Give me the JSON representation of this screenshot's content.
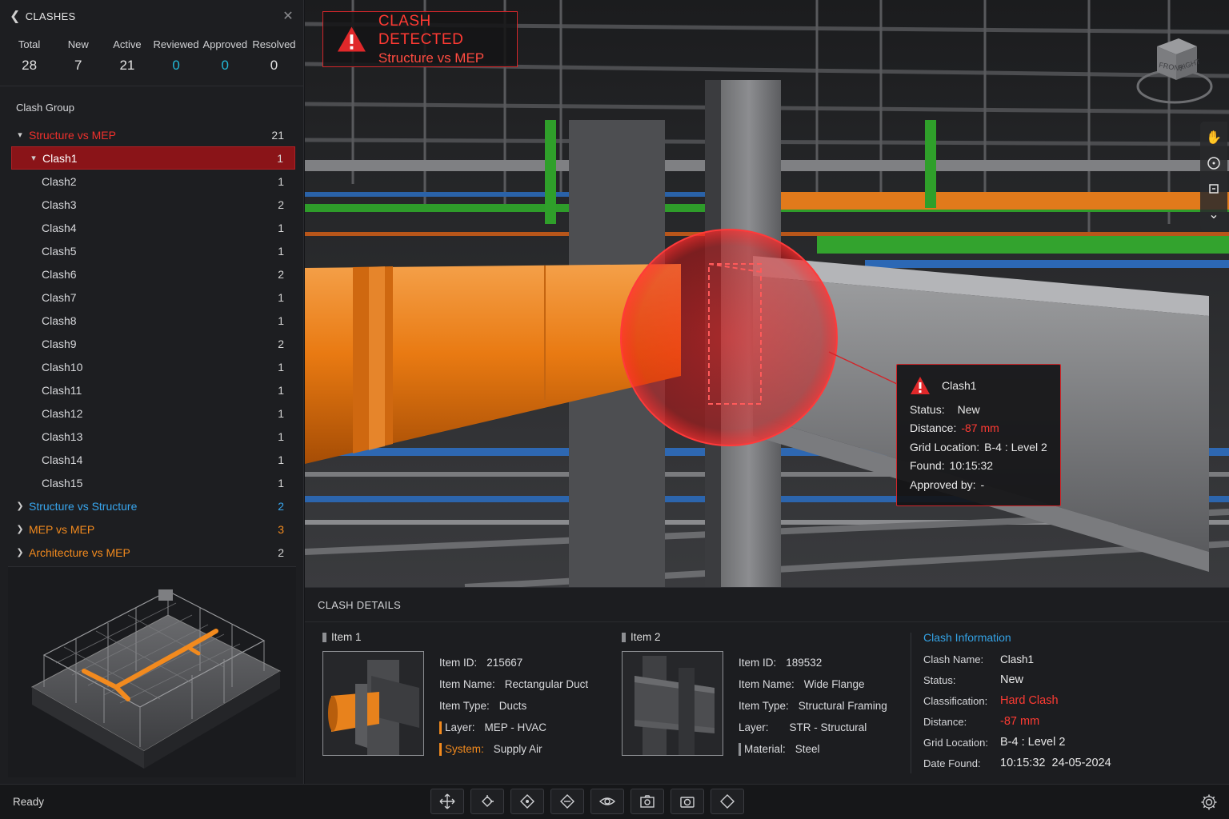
{
  "panel": {
    "back_icon": "chevron-left",
    "title": "CLASHES",
    "close_icon": "close"
  },
  "stats": [
    {
      "label": "Total",
      "value": "28",
      "color": "#e3e3e3"
    },
    {
      "label": "New",
      "value": "7",
      "color": "#e3e3e3"
    },
    {
      "label": "Active",
      "value": "21",
      "color": "#e3e3e3"
    },
    {
      "label": "Reviewed",
      "value": "0",
      "color": "#22b8d6"
    },
    {
      "label": "Approved",
      "value": "0",
      "color": "#22b8d6"
    },
    {
      "label": "Resolved",
      "value": "0",
      "color": "#e3e3e3"
    }
  ],
  "group_header": "Clash Group",
  "groups": [
    {
      "name": "Structure vs MEP",
      "count": "21",
      "expanded": true,
      "color": "#f0302c",
      "children": [
        {
          "name": "Clash1",
          "count": "1",
          "selected": true
        },
        {
          "name": "Clash2",
          "count": "1"
        },
        {
          "name": "Clash3",
          "count": "2"
        },
        {
          "name": "Clash4",
          "count": "1"
        },
        {
          "name": "Clash5",
          "count": "1"
        },
        {
          "name": "Clash6",
          "count": "2"
        },
        {
          "name": "Clash7",
          "count": "1"
        },
        {
          "name": "Clash8",
          "count": "1"
        },
        {
          "name": "Clash9",
          "count": "2"
        },
        {
          "name": "Clash10",
          "count": "1"
        },
        {
          "name": "Clash11",
          "count": "1"
        },
        {
          "name": "Clash12",
          "count": "1"
        },
        {
          "name": "Clash13",
          "count": "1"
        },
        {
          "name": "Clash14",
          "count": "1"
        },
        {
          "name": "Clash15",
          "count": "1"
        }
      ]
    },
    {
      "name": "Structure vs Structure",
      "count": "2",
      "expanded": false,
      "color": "#38a6ee"
    },
    {
      "name": "MEP vs MEP",
      "count": "3",
      "expanded": false,
      "color": "#f28a1e"
    },
    {
      "name": "Architecture vs MEP",
      "count": "2",
      "expanded": false,
      "color": "#f28a1e"
    }
  ],
  "banner": {
    "line1": "CLASH DETECTED",
    "line2": "Structure vs MEP",
    "icon": "warning-icon"
  },
  "view_cube": {
    "front": "FRONT",
    "right": "RIGHT"
  },
  "nav_tools": [
    "hand-pan",
    "orbit",
    "look",
    "chevron-down"
  ],
  "tooltip": {
    "title": "Clash1",
    "status_k": "Status:",
    "status_v": "New",
    "distance_k": "Distance:",
    "distance_v": "-87 mm",
    "grid_k": "Grid Location:",
    "grid_v": "B-4 : Level 2",
    "found_k": "Found:",
    "found_v": "10:15:32",
    "approved_k": "Approved by:",
    "approved_v": "-"
  },
  "details": {
    "title": "CLASH DETAILS",
    "item1": {
      "title": "Item 1",
      "id_k": "Item ID:",
      "id_v": "215667",
      "name_k": "Item Name:",
      "name_v": "Rectangular Duct",
      "type_k": "Item Type:",
      "type_v": "Ducts",
      "layer_k": "Layer:",
      "layer_v": "MEP - HVAC",
      "sys_k": "System:",
      "sys_v": "Supply Air"
    },
    "item2": {
      "title": "Item 2",
      "id_k": "Item ID:",
      "id_v": "189532",
      "name_k": "Item Name:",
      "name_v": "Wide Flange",
      "type_k": "Item Type:",
      "type_v": "Structural Framing",
      "layer_k": "Layer:",
      "layer_v": "STR - Structural",
      "mat_k": "Material:",
      "mat_v": "Steel"
    },
    "info": {
      "title": "Clash Information",
      "name_k": "Clash Name:",
      "name_v": "Clash1",
      "status_k": "Status:",
      "status_v": "New",
      "class_k": "Classification:",
      "class_v": "Hard Clash",
      "dist_k": "Distance:",
      "dist_v": "-87 mm",
      "grid_k": "Grid Location:",
      "grid_v": "B-4 : Level 2",
      "date_k": "Date Found:",
      "date_v": "10:15:32  24-05-2024"
    }
  },
  "status": "Ready",
  "toolbar": [
    "move-tool",
    "select-tool",
    "section-tool",
    "measure-tool",
    "view-tool",
    "camera-tool",
    "screenshot-tool",
    "markup-tool"
  ],
  "colors": {
    "accent_red": "#d1262a",
    "duct_orange": "#f28a1e",
    "link_blue": "#38a6ee",
    "cyan": "#22b8d6"
  }
}
